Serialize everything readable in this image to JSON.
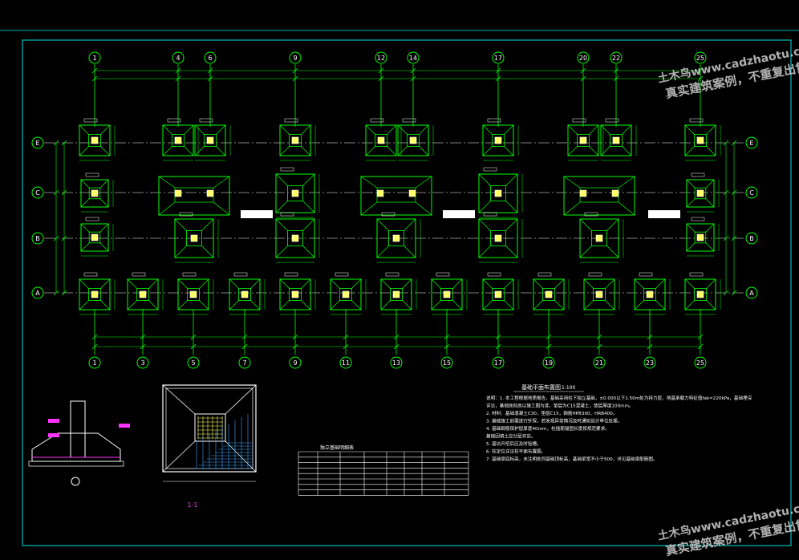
{
  "drawing": {
    "plan_title": "基础平面布置图",
    "plan_scale": "1:100",
    "section_title": "1-1",
    "table_title": "独立基础明细表",
    "note_lines": [
      "说明：1. 本工程根据地质报告，基础采用柱下独立基础，±0.000以下1.50m处为持力层，地基承载力特征值fak=220kPa，基础埋深",
      "     详见，基础底标高以施工图为准，垫层为C15混凝土，垫层厚度100mm。",
      "  2. 材料：基础混凝土C30，垫层C15，钢筋HPB300、HRB400。",
      "  3. 基础施工前需进行钎探，若发现异常情况及时通知设计单位处理。",
      "  4. 基础钢筋保护层厚度40mm，柱插筋锚固长度按规范要求。",
      "     基础回填土应分层夯实。",
      "  5. 基坑开挖后应及时验槽。",
      "  6. 柱定位详见柱平面布置图。",
      "  7. 基础梁底标高，未注明处同基础顶标高，基础梁宽不小于500，详见基础梁配筋图。"
    ],
    "top_axes": [
      "1",
      "4",
      "6",
      "9",
      "12",
      "14",
      "17",
      "20",
      "22",
      "25"
    ],
    "bottom_axes": [
      "1",
      "3",
      "5",
      "7",
      "9",
      "11",
      "13",
      "15",
      "17",
      "19",
      "21",
      "23",
      "25"
    ],
    "row_axes": [
      "E",
      "C",
      "B",
      "A"
    ],
    "watermark_line1": "土木鸟www.cadzhaotu.cn",
    "watermark_line2": "真实建筑案例，不重复出售"
  }
}
